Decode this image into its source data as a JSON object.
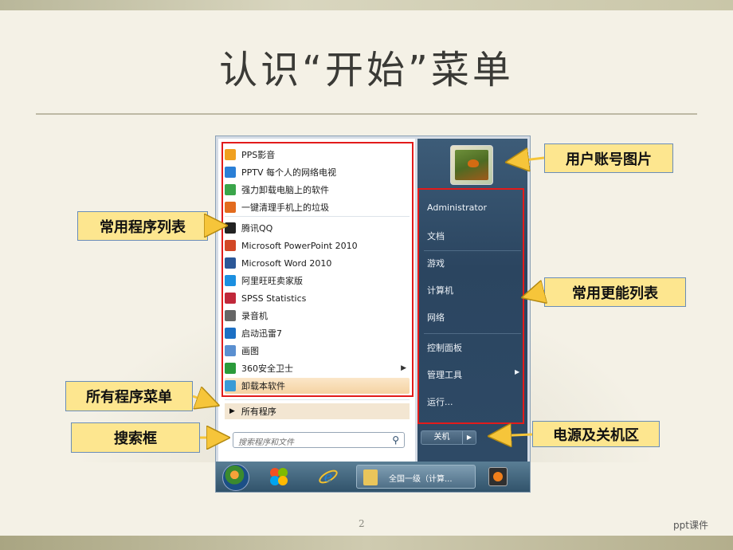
{
  "slide": {
    "title": "认识“开始”菜单",
    "page_number": "2",
    "footer": "ppt课件"
  },
  "start_menu": {
    "programs": [
      {
        "label": "PPS影音",
        "icon": "pps-icon",
        "color": "#f0a020"
      },
      {
        "label": "PPTV 每个人的网络电视",
        "icon": "pptv-icon",
        "color": "#2a7fd6"
      },
      {
        "label": "强力卸载电脑上的软件",
        "icon": "uninstall-icon",
        "color": "#3aa54a"
      },
      {
        "label": "一键清理手机上的垃圾",
        "icon": "cleaner-icon",
        "color": "#e36b1e"
      },
      {
        "label": "腾讯QQ",
        "icon": "qq-icon",
        "color": "#222222"
      },
      {
        "label": "Microsoft PowerPoint 2010",
        "icon": "powerpoint-icon",
        "color": "#d24726"
      },
      {
        "label": "Microsoft Word 2010",
        "icon": "word-icon",
        "color": "#2b5797"
      },
      {
        "label": "阿里旺旺卖家版",
        "icon": "aliwangwang-icon",
        "color": "#1b8fe0"
      },
      {
        "label": "SPSS Statistics",
        "icon": "spss-icon",
        "color": "#c0283a"
      },
      {
        "label": "录音机",
        "icon": "microphone-icon",
        "color": "#666666"
      },
      {
        "label": "启动迅雷7",
        "icon": "thunder-icon",
        "color": "#1c6fc4"
      },
      {
        "label": "画图",
        "icon": "paint-icon",
        "color": "#5a8fd0"
      },
      {
        "label": "360安全卫士",
        "icon": "360-icon",
        "color": "#2a9a3a",
        "has_submenu": true
      },
      {
        "label": "卸载本软件",
        "icon": "uninstall-self-icon",
        "color": "#3a9ad6",
        "highlighted": true
      }
    ],
    "all_programs_label": "所有程序",
    "search_placeholder": "搜索程序和文件",
    "right_items": [
      {
        "label": "Administrator"
      },
      {
        "label": "文档"
      },
      {
        "label": "游戏"
      },
      {
        "label": "计算机"
      },
      {
        "label": "网络"
      },
      {
        "label": "控制面板"
      },
      {
        "label": "管理工具",
        "has_submenu": true
      },
      {
        "label": "运行..."
      }
    ],
    "shutdown_label": "关机",
    "taskbar": {
      "window_label": "全国一级（计算..."
    }
  },
  "callouts": {
    "user_picture": "用户账号图片",
    "common_programs": "常用程序列表",
    "common_functions": "常用更能列表",
    "all_programs_menu": "所有程序菜单",
    "search_box": "搜索框",
    "power_area": "电源及关机区"
  },
  "colors": {
    "highlight_box": "#e21b1b",
    "callout_fill": "#fde68f",
    "callout_border": "#6a8db8"
  }
}
